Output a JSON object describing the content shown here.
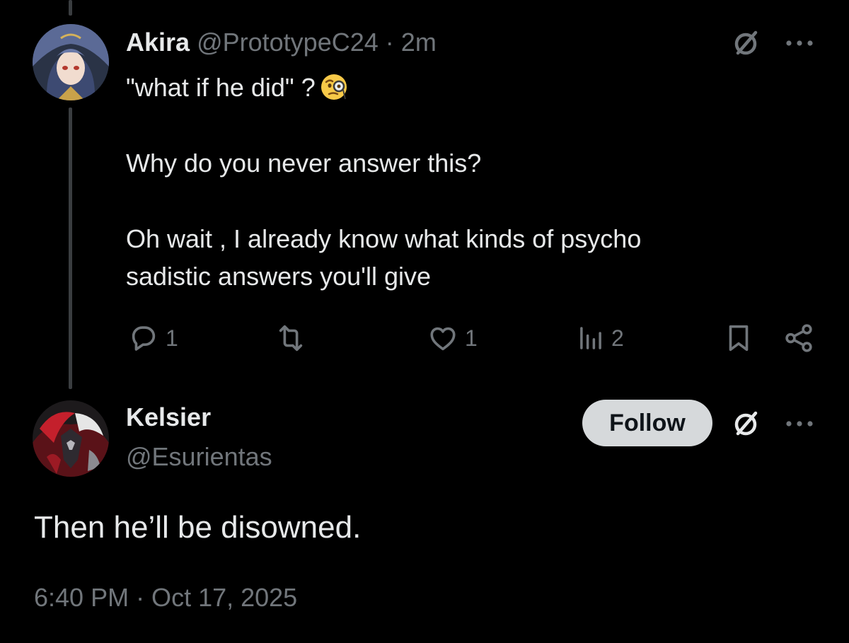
{
  "parent_tweet": {
    "author": {
      "display_name": "Akira",
      "handle": "@PrototypeC24",
      "separator": "·",
      "time_ago": "2m"
    },
    "lines": [
      "\"what if he did\" ?",
      "Why do you never answer this?",
      "Oh wait , I already know what kinds of psycho",
      "sadistic answers you'll give"
    ],
    "emoji": "monocle-face",
    "actions": {
      "reply_count": "1",
      "retweet_count": "",
      "like_count": "1",
      "view_count": "2"
    }
  },
  "main_tweet": {
    "author": {
      "display_name": "Kelsier",
      "handle": "@Esurientas"
    },
    "follow_label": "Follow",
    "text": "Then he’ll be disowned.",
    "timestamp": "6:40 PM · Oct 17, 2025"
  },
  "icons": {
    "grok": "grok-icon",
    "more": "more-icon",
    "reply": "reply-icon",
    "retweet": "retweet-icon",
    "like": "like-icon",
    "views": "views-icon",
    "bookmark": "bookmark-icon",
    "share": "share-icon"
  },
  "colors": {
    "background": "#000000",
    "text_primary": "#e7e9ea",
    "text_secondary": "#71767b",
    "thread_line": "#3a3d40",
    "follow_bg": "#d6d9db"
  }
}
